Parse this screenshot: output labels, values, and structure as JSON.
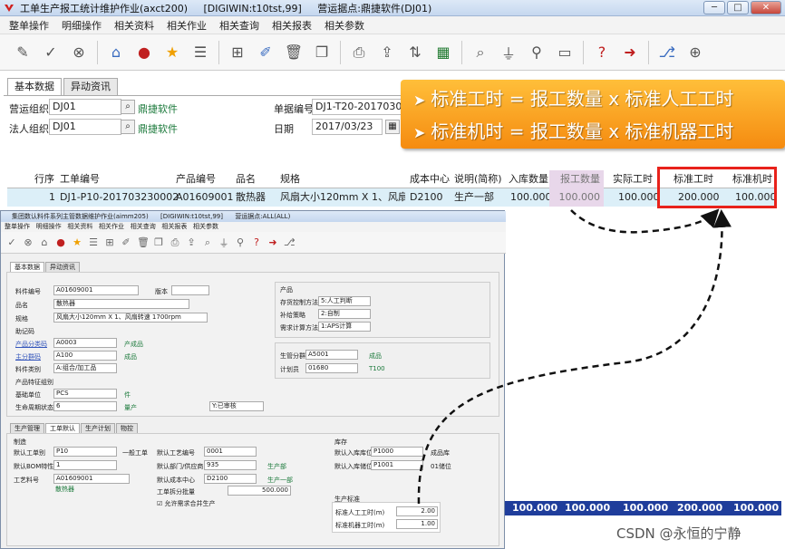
{
  "window": {
    "title": "工单生产报工统计维护作业(axct200)     [DIGIWIN:t10tst,99]     营运据点:鼎捷软件(DJ01)",
    "buttons": {
      "minimize": "─",
      "maximize": "□",
      "close": "✕"
    }
  },
  "menu": [
    "整单操作",
    "明细操作",
    "相关资料",
    "相关作业",
    "相关查询",
    "相关报表",
    "相关参数"
  ],
  "toolbar": {
    "icons": [
      "edit-icon",
      "confirm-icon",
      "cancel-icon",
      "home-icon",
      "location-icon",
      "favorite-icon",
      "list-icon",
      "new-icon",
      "modify-icon",
      "delete-icon",
      "copy-icon",
      "print-icon",
      "export-icon",
      "import-icon",
      "excel-icon",
      "search-icon",
      "filter-icon",
      "query-icon",
      "maximize-icon",
      "help-icon",
      "exit-icon",
      "attach-icon",
      "position-icon"
    ]
  },
  "tabs": [
    "基本数据",
    "异动资讯"
  ],
  "form": {
    "org_label": "营运组织",
    "org_value": "DJ01",
    "org_name": "鼎捷软件",
    "legal_label": "法人组织",
    "legal_value": "DJ01",
    "legal_name": "鼎捷软件",
    "doc_label": "单据编号",
    "doc_value": "DJ1-T20-201703000",
    "date_label": "日期",
    "date_value": "2017/03/23"
  },
  "callout": {
    "line1": "标准工时 = 报工数量 x 标准人工工时",
    "line2": "标准机时 = 报工数量 x 标准机器工时"
  },
  "grid": {
    "headers": [
      "行序",
      "工单编号",
      "产品编号",
      "品名",
      "规格",
      "成本中心",
      "说明(简称)",
      "入库数量",
      "报工数量",
      "实际工时",
      "标准工时",
      "标准机时"
    ],
    "row": [
      "1",
      "DJ1-P10-201703230002",
      "A01609001",
      "散热器",
      "风扇大小120mm X 1、风扇...",
      "D2100",
      "生产一部",
      "100.000",
      "100.000",
      "100.000",
      "200.000",
      "100.000"
    ]
  },
  "overlay": {
    "title": "集团数认料件系列主管数据维护作业(aimm205)      [DIGIWIN:t10tst,99]      营运据点:ALL(ALL)",
    "menu": "整单操作   明细操作   相关资料   相关作业   相关查询   相关报表   相关参数",
    "tabs": [
      "基本数据",
      "异动资讯"
    ],
    "item_no_label": "料件编号",
    "item_no": "A01609001",
    "version_label": "版本",
    "name_label": "品名",
    "name": "散热器",
    "spec_label": "规格",
    "spec": "风扇大小120mm X 1、风扇转速 1700rpm",
    "memo_label": "助记码",
    "cat_label": "产品分类码",
    "cat": "A0003",
    "cat_name": "产成品",
    "main_label": "主分群码",
    "main": "A100",
    "main_name": "成品",
    "type_label": "料件类别",
    "type": "A:组合/加工品",
    "feature_label": "产品特征组别",
    "unit_label": "基础单位",
    "unit": "PCS",
    "unit_name": "件",
    "life_label": "生命周期状态",
    "life": "6",
    "life_name": "量产",
    "review": "Y:已审核",
    "prod_group": "产品",
    "inv_label": "存货控制方法",
    "inv": "5:人工判断",
    "rep_label": "补给策略",
    "rep": "2:自制",
    "req_label": "需求计算方法",
    "req": "1:APS计算",
    "mgr_label": "生管分群",
    "mgr": "A5001",
    "mgr_name": "成品",
    "planner_label": "计划员",
    "planner": "01680",
    "planner_name": "T100",
    "subtabs": [
      "生产管理",
      "工单默认",
      "生产计划",
      "物控"
    ],
    "mfg_group": "制造",
    "wo_type_label": "默认工单别",
    "wo_type": "P10",
    "wo_type_name": "一般工单",
    "bom_label": "默认BOM特性",
    "bom": "1",
    "route_label": "工艺料号",
    "route": "A01609001",
    "route_name": "散热器",
    "op_label": "默认工艺编号",
    "op": "0001",
    "dept_label": "默认部门/供应商",
    "dept": "935",
    "dept_name": "生产部",
    "cc_label": "默认成本中心",
    "cc": "D2100",
    "cc_name": "生产一部",
    "split_label": "工单拆分批量",
    "split": "500.000",
    "allow_merge": "允许需求合并生产",
    "stock_group": "库存",
    "wh_label": "默认入库库位",
    "wh": "P1000",
    "wh_name": "成品库",
    "loc_label": "默认入库储位",
    "loc": "P1001",
    "loc_name": "01储位",
    "std_group": "生产标准",
    "labor_label": "标准人工工时(m)",
    "labor": "2.00",
    "machine_label": "标准机器工时(m)",
    "machine": "1.00"
  },
  "bottom_row": [
    "100.000",
    "100.000",
    "100.000",
    "200.000",
    "100.000"
  ],
  "watermark": "CSDN @永恒的宁静",
  "colors": {
    "callout": "#f58b10",
    "highlight": "#e8221b",
    "bottom_row": "#1f3d9b"
  }
}
